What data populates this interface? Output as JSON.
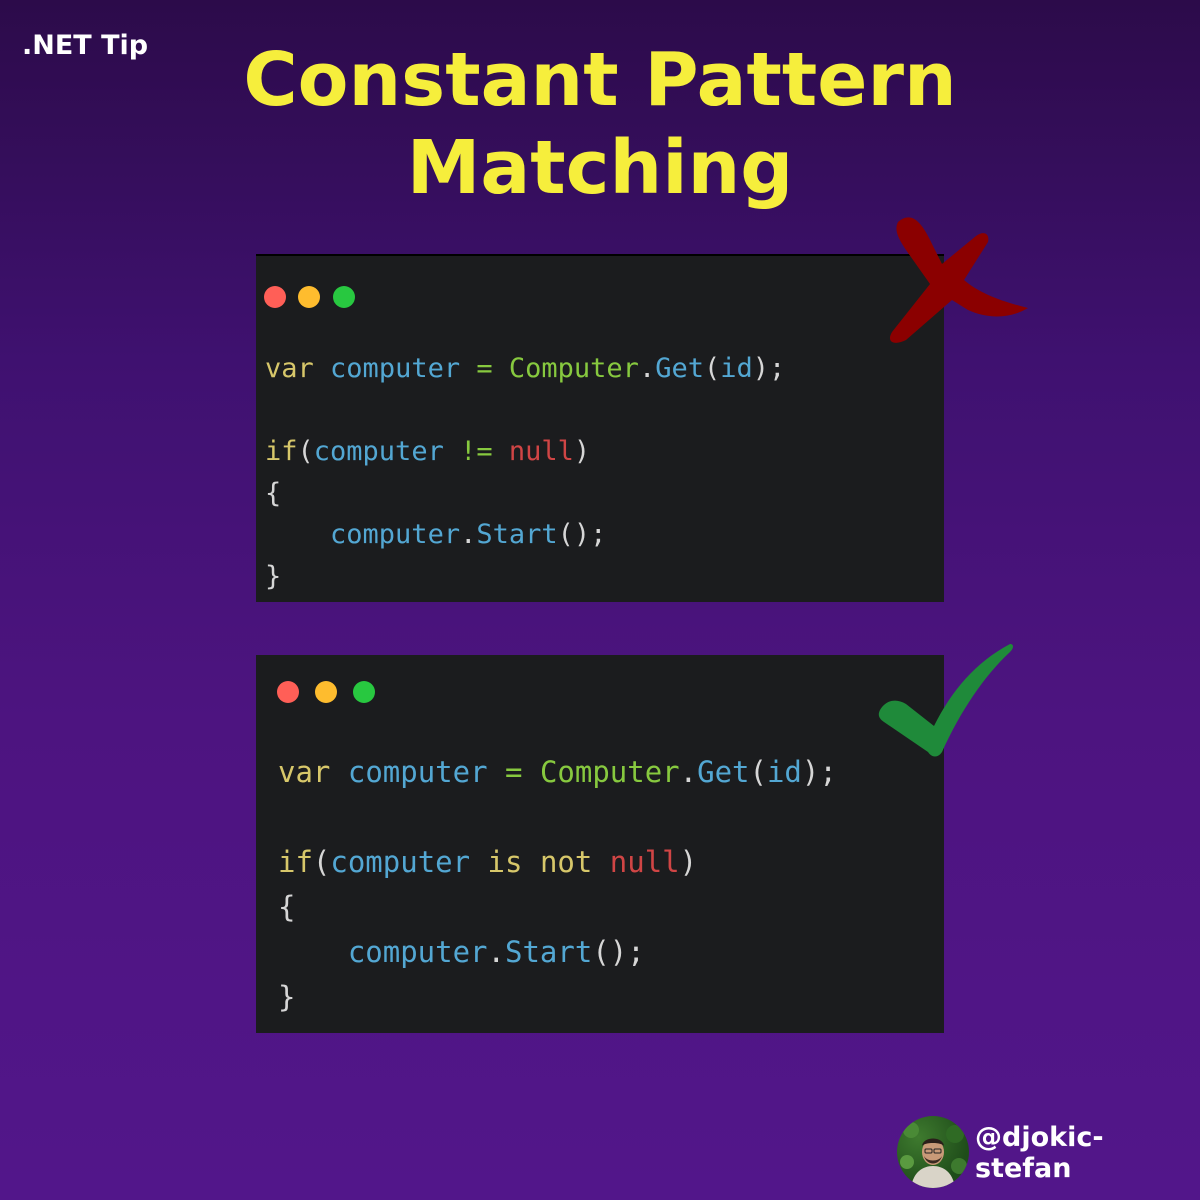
{
  "tag": ".NET Tip",
  "title": {
    "line1": "Constant Pattern",
    "line2": "Matching"
  },
  "colors": {
    "title": "#f6ee3c",
    "panel_bg": "#1b1c1e",
    "keyword": "#d7c76a",
    "identifier": "#53a7d3",
    "class": "#87c93f",
    "null": "#d04545",
    "cross_mark": "#8b0000",
    "check_mark": "#1f8a3a"
  },
  "window_controls": [
    "close-dot",
    "minimize-dot",
    "maximize-dot"
  ],
  "code_bad": {
    "mark_icon": "cross-icon",
    "line1": {
      "kw": "var",
      "var": "computer",
      "op": "=",
      "cls": "Computer",
      "dot": ".",
      "meth": "Get",
      "open": "(",
      "arg": "id",
      "close": ");"
    },
    "line2": {
      "kw": "if",
      "open": "(",
      "var": "computer",
      "op": "!=",
      "nul": "null",
      "close": ")"
    },
    "line3": "{",
    "line4": {
      "var": "computer",
      "dot": ".",
      "meth": "Start",
      "call": "();"
    },
    "line5": "}"
  },
  "code_good": {
    "mark_icon": "check-icon",
    "line1": {
      "kw": "var",
      "var": "computer",
      "op": "=",
      "cls": "Computer",
      "dot": ".",
      "meth": "Get",
      "open": "(",
      "arg": "id",
      "close": ");"
    },
    "line2": {
      "kw": "if",
      "open": "(",
      "var": "computer",
      "is": "is",
      "not": "not",
      "nul": "null",
      "close": ")"
    },
    "line3": "{",
    "line4": {
      "var": "computer",
      "dot": ".",
      "meth": "Start",
      "call": "();"
    },
    "line5": "}"
  },
  "author": {
    "handle": "@djokic-stefan",
    "avatar_icon": "avatar"
  }
}
